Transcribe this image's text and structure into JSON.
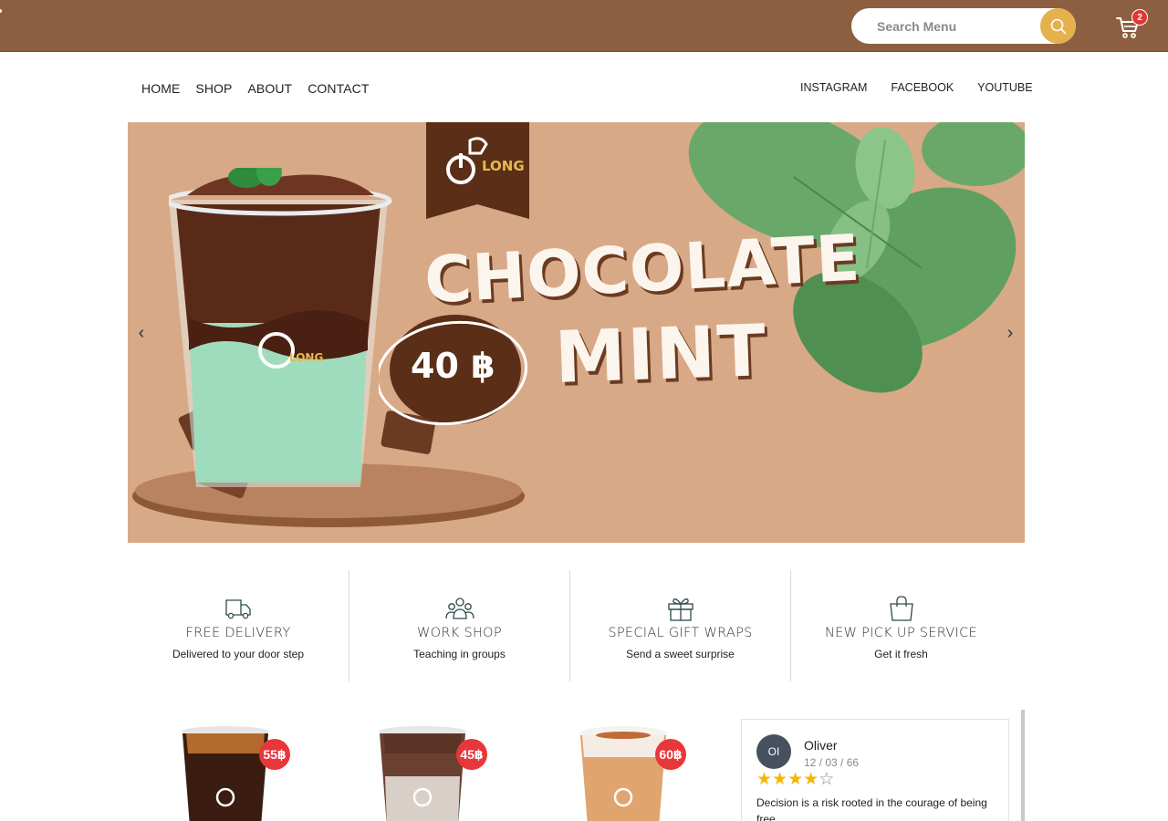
{
  "header": {
    "search": {
      "placeholder": "Search Menu"
    },
    "cart": {
      "count": "2"
    },
    "icons": {
      "search": "search-icon",
      "cart": "cart-icon"
    }
  },
  "nav": {
    "left": [
      "HOME",
      "SHOP",
      "ABOUT",
      "CONTACT"
    ],
    "right": [
      "INSTAGRAM",
      "FACEBOOK",
      "YOUTUBE"
    ]
  },
  "banner": {
    "title_line1": "CHOCOLATE",
    "title_line2": "MINT",
    "price": "40 ฿",
    "logo_text": "LONG",
    "background": "#d8a987",
    "arrows": {
      "prev": "‹",
      "next": "›"
    }
  },
  "features": [
    {
      "icon": "truck-icon",
      "title": "FREE DELIVERY",
      "subtitle": "Delivered to your door step"
    },
    {
      "icon": "group-icon",
      "title": "WORK SHOP",
      "subtitle": "Teaching in groups"
    },
    {
      "icon": "gift-icon",
      "title": "SPECIAL GIFT WRAPS",
      "subtitle": "Send a sweet surprise"
    },
    {
      "icon": "shopping-bag-icon",
      "title": "NEW PICK UP SERVICE",
      "subtitle": "Get it fresh"
    }
  ],
  "products": [
    {
      "price": "55฿"
    },
    {
      "price": "45฿"
    },
    {
      "price": "60฿"
    }
  ],
  "review": {
    "initials": "OI",
    "name": "Oliver",
    "date": "12 / 03 / 66",
    "rating": 4,
    "max_rating": 5,
    "text": "Decision is a risk rooted in the courage of being free."
  },
  "colors": {
    "topbar": "#8c5f41",
    "search_button": "#e5b14d",
    "badge": "#e8373b",
    "star": "#f2b705"
  }
}
